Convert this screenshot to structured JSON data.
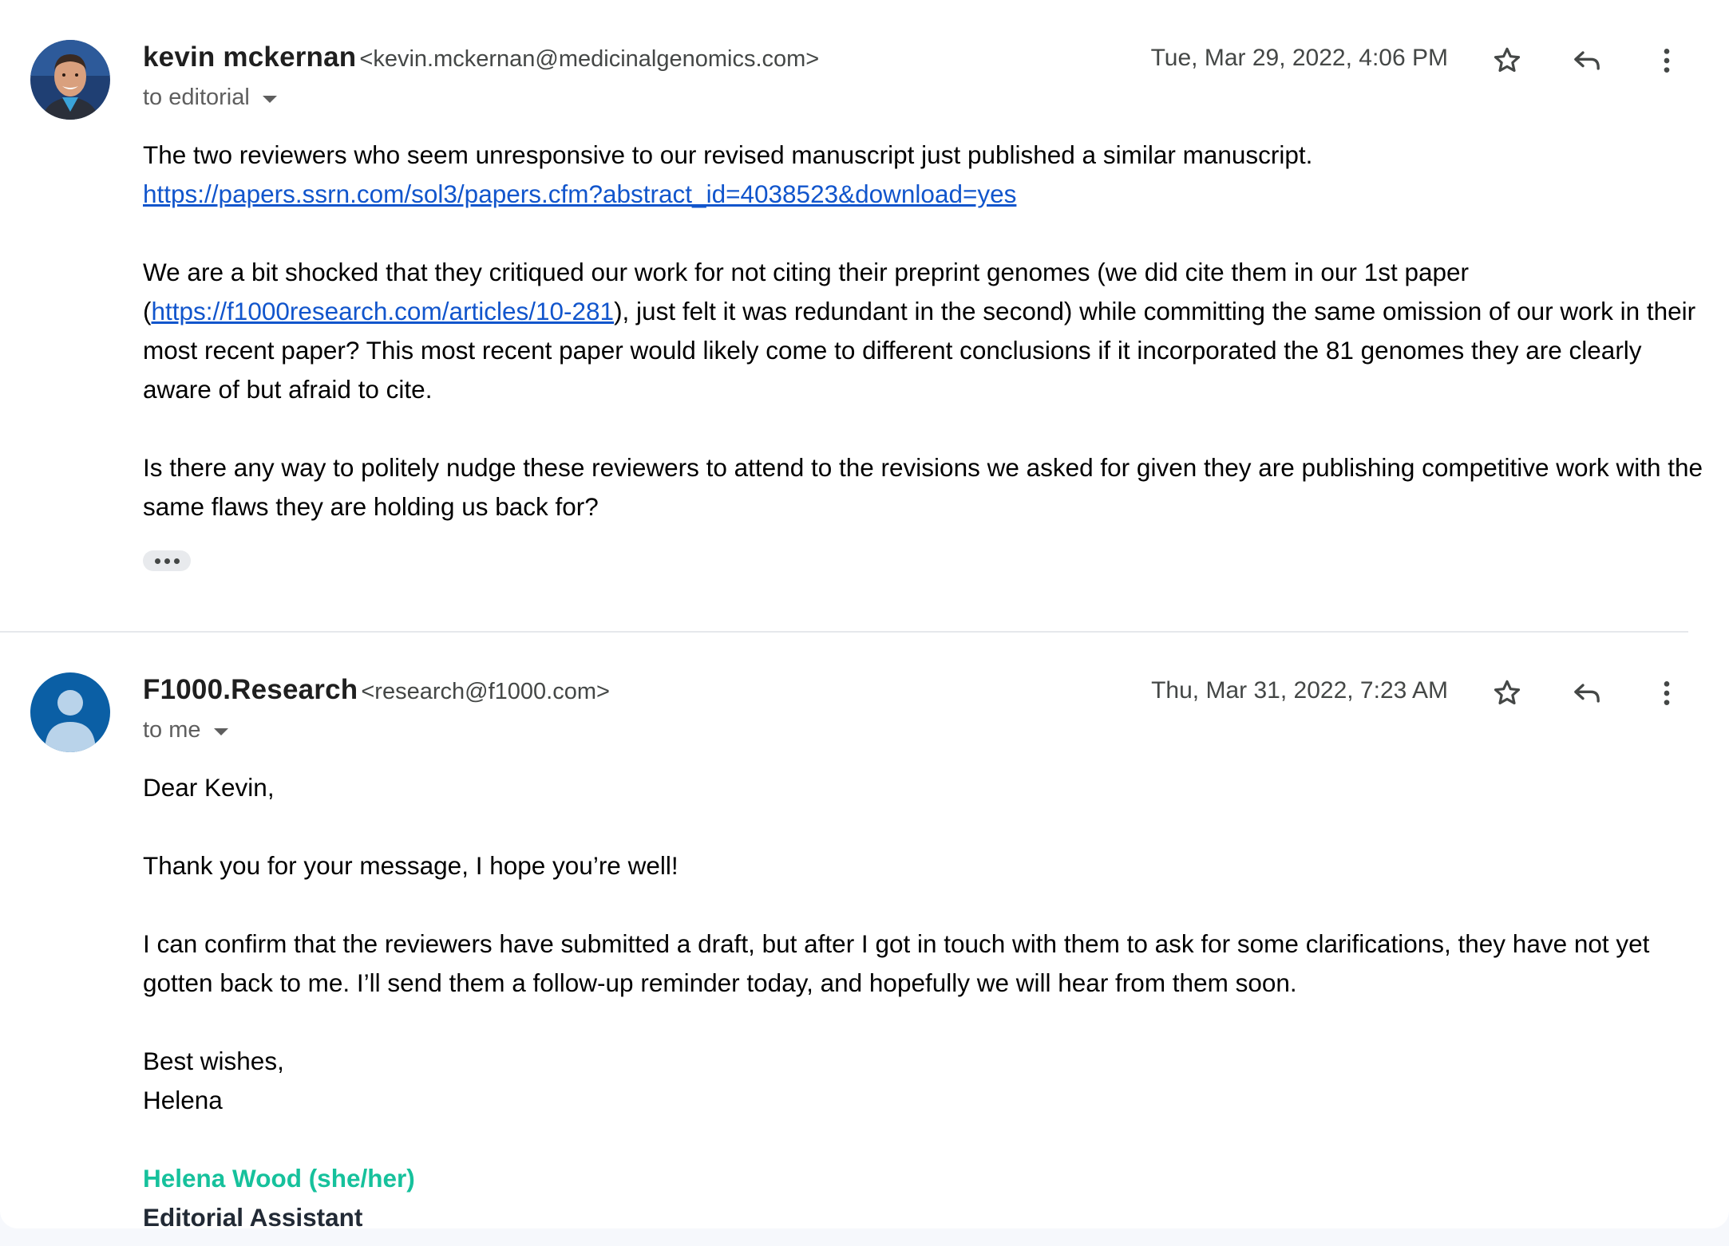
{
  "messages": [
    {
      "sender_name": "kevin mckernan",
      "sender_email": "<kevin.mckernan@medicinalgenomics.com>",
      "recipient": "to editorial",
      "date": "Tue, Mar 29, 2022, 4:06 PM",
      "avatar": "profile-photo",
      "body": {
        "p1_text": "The two reviewers who seem unresponsive to our revised manuscript just published a similar manuscript.",
        "p1_link": "https://papers.ssrn.com/sol3/papers.cfm?abstract_id=4038523&download=yes",
        "p2_before": "We are a bit shocked that they critiqued our work for not citing their preprint genomes (we did cite them in our 1st paper (",
        "p2_link": "https://f1000research.com/articles/10-281",
        "p2_after": "), just felt it was redundant in the second) while committing the same omission of our work in their most recent paper? This most recent paper would likely come to different conclusions if it incorporated the 81 genomes they are clearly aware of but afraid to cite.",
        "p3": "Is there any way to politely nudge these reviewers to attend to the revisions we asked for given they are publishing competitive work with the same flaws they are holding us back for?"
      }
    },
    {
      "sender_name": "F1000.Research",
      "sender_email": "<research@f1000.com>",
      "recipient": "to me",
      "date": "Thu, Mar 31, 2022, 7:23 AM",
      "avatar": "default-person-icon",
      "body": {
        "greeting": "Dear Kevin,",
        "p1": "Thank you for your message, I hope you’re well!",
        "p2": "I can confirm that the reviewers have submitted a draft, but after I got in touch with them to ask for some clarifications, they have not yet gotten back to me. I’ll send them a follow-up reminder today, and hopefully we will hear from them soon.",
        "closing": "Best wishes,",
        "closing_name": "Helena",
        "sig_name": "Helena Wood (she/her)",
        "sig_title": "Editorial Assistant"
      }
    }
  ],
  "colors": {
    "link": "#1155cc",
    "signature_name": "#16c19c",
    "avatar_default_bg": "#0b5fa5"
  },
  "icons": [
    "star-icon",
    "reply-icon",
    "more-vert-icon",
    "ellipsis-icon"
  ]
}
